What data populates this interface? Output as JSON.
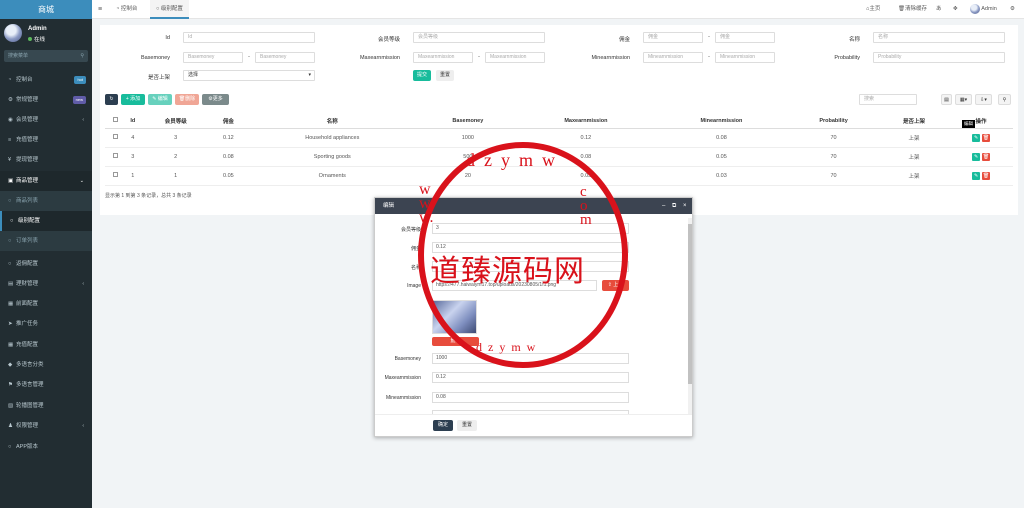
{
  "sidebar": {
    "brand": "商城",
    "user_name": "Admin",
    "user_status": "在线",
    "search_placeholder": "搜索菜单",
    "items": [
      {
        "label": "控制台",
        "badge": "hot",
        "badge_color": "#00a65a"
      },
      {
        "label": "常规管理",
        "badge": "new",
        "badge_color": "#605ca8"
      },
      {
        "label": "会员管理"
      },
      {
        "label": "充值管理"
      },
      {
        "label": "提现管理"
      },
      {
        "label": "商品管理"
      },
      {
        "label": "商品列表"
      },
      {
        "label": "级别配置"
      },
      {
        "label": "订单列表"
      },
      {
        "label": "返佣配置"
      },
      {
        "label": "理财管理"
      },
      {
        "label": "前面配置"
      },
      {
        "label": "推广任务"
      },
      {
        "label": "充值配置"
      },
      {
        "label": "多语言分类"
      },
      {
        "label": "多语言管理"
      },
      {
        "label": "轮播图管理"
      },
      {
        "label": "权限管理"
      },
      {
        "label": "APP版本"
      }
    ]
  },
  "topbar": {
    "tab1": "控制台",
    "tab2": "级别配置",
    "home": "主页",
    "clear_cache": "清除缓存",
    "user": "Admin"
  },
  "filters": {
    "id_label": "Id",
    "id_ph": "Id",
    "level_label": "会员等级",
    "level_ph": "会员等级",
    "commission_label": "佣金",
    "commission_ph1": "佣金",
    "commission_ph2": "佣金",
    "name_label": "名称",
    "name_ph": "名称",
    "basemoney_label": "Basemoney",
    "basemoney_ph1": "Basemoney",
    "basemoney_ph2": "Basemoney",
    "maxe_label": "Maxearnmission",
    "maxe_ph1": "Maxearnmission",
    "maxe_ph2": "Maxearnmission",
    "mine_label": "Minearnmission",
    "mine_ph1": "Minearnmission",
    "mine_ph2": "Minearnmission",
    "prob_label": "Probability",
    "prob_ph": "Probability",
    "shelf_label": "是否上架",
    "shelf_value": "选择",
    "submit": "提交",
    "reset": "重置"
  },
  "toolbar": {
    "add": "添加",
    "edit": "编辑",
    "delete": "删除",
    "more": "更多",
    "search_ph": "搜索"
  },
  "table": {
    "headers": [
      "Id",
      "会员等级",
      "佣金",
      "名称",
      "Basemoney",
      "Maxearnmission",
      "Minearnmission",
      "Probability",
      "是否上架",
      "操作"
    ],
    "rows": [
      [
        "4",
        "3",
        "0.12",
        "Household appliances",
        "1000",
        "0.12",
        "0.08",
        "70",
        "上架"
      ],
      [
        "3",
        "2",
        "0.08",
        "Sporting goods",
        "500",
        "0.08",
        "0.05",
        "70",
        "上架"
      ],
      [
        "1",
        "1",
        "0.05",
        "Ornaments",
        "20",
        "0.05",
        "0.03",
        "70",
        "上架"
      ]
    ],
    "tooltip": "编辑",
    "summary": "显示第 1 到第 3 条记录，总共 3 条记录"
  },
  "modal": {
    "title": "编辑",
    "level_label": "会员等级",
    "level_value": "3",
    "commission_label": "佣金",
    "commission_value": "0.12",
    "name_label": "名称",
    "name_value": "",
    "image_label": "Image",
    "image_value": "https://477.haiwaiym17.top/uploads/20230805/1f1.png",
    "upload": "上传",
    "delete": "删除",
    "basemoney_label": "Basemoney",
    "basemoney_value": "1000",
    "maxe_label": "Maxearnmission",
    "maxe_value": "0.12",
    "mine_label": "Minearnmission",
    "mine_value": "0.08",
    "ok": "确定",
    "reset": "重置"
  },
  "watermark": {
    "text": "道臻源码网",
    "top": "dzymw",
    "side": "www.",
    "com": "com"
  }
}
